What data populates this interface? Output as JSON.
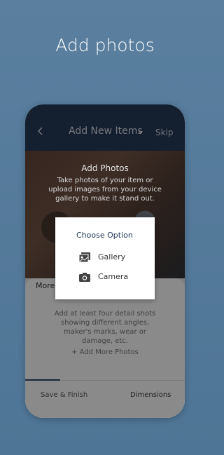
{
  "headline": "Add photos",
  "app": {
    "nav": {
      "title": "Add New Items",
      "skip_label": "Skip"
    },
    "hero": {
      "title": "Add Photos",
      "subtitle": "Take photos of your item or upload images from your device gallery to make it stand out."
    },
    "sheet": {
      "label": "More",
      "helper_text": "Add at least four detail shots showing different angles, maker's marks, wear or damage, etc.",
      "add_more_label": "+ Add More Photos",
      "tabs": [
        {
          "label": "Save & Finish",
          "active": true
        },
        {
          "label": "Dimensions",
          "active": false
        }
      ]
    },
    "dialog": {
      "title": "Choose Option",
      "options": [
        {
          "label": "Gallery",
          "icon": "gallery-icon"
        },
        {
          "label": "Camera",
          "icon": "camera-icon"
        }
      ]
    }
  },
  "colors": {
    "background": "#5a7f9f",
    "topbar": "#263a56",
    "accent": "#233b5c"
  }
}
